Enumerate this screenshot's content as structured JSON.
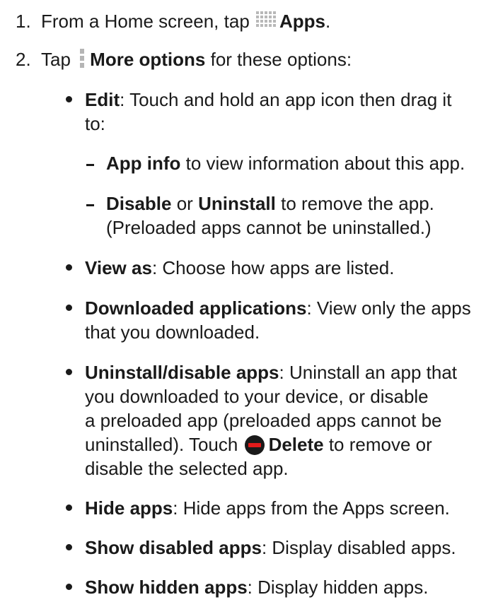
{
  "steps": [
    {
      "number": "1.",
      "pre": "From a Home screen, tap ",
      "icon": "apps-grid-icon",
      "bold": "Apps",
      "post": "."
    },
    {
      "number": "2.",
      "pre": "Tap ",
      "icon": "more-options-icon",
      "bold": "More options",
      "post": " for these options:"
    }
  ],
  "options": {
    "edit": {
      "label": "Edit",
      "text1": ": Touch and hold an app icon then drag it",
      "text2": "to:"
    },
    "edit_sub": [
      {
        "bold": "App info",
        "text": " to view information about this app."
      },
      {
        "bold1": "Disable",
        "mid": " or ",
        "bold2": "Uninstall",
        "text": " to remove the app.",
        "line2": "(Preloaded apps cannot be uninstalled.)"
      }
    ],
    "view_as": {
      "label": "View as",
      "text": ": Choose how apps are listed."
    },
    "downloaded": {
      "label": "Downloaded applications",
      "text1": ": View only the apps",
      "text2": "that you downloaded."
    },
    "uninstall_disable": {
      "label": "Uninstall/disable apps",
      "text1": ": Uninstall an app that",
      "line2": "you downloaded to your device, or disable",
      "line3": "a preloaded app (preloaded apps cannot be",
      "line4_pre": "uninstalled). Touch ",
      "icon": "delete-icon",
      "line4_bold": "Delete",
      "line4_post": " to remove or",
      "line5": "disable the selected app."
    },
    "hide_apps": {
      "label": "Hide apps",
      "text": ": Hide apps from the Apps screen."
    },
    "show_disabled": {
      "label": "Show disabled apps",
      "text": ": Display disabled apps."
    },
    "show_hidden": {
      "label": "Show hidden apps",
      "text": ": Display hidden apps."
    }
  },
  "colors": {
    "text": "#1a1a1a",
    "icon_gray": "#b8b8b8",
    "delete_red": "#e21b1b"
  }
}
